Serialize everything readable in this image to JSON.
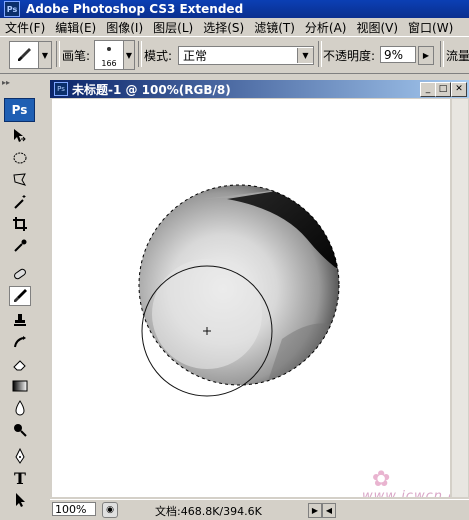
{
  "app": {
    "title": "Adobe Photoshop CS3 Extended",
    "logo": "Ps"
  },
  "menu": [
    "文件(F)",
    "编辑(E)",
    "图像(I)",
    "图层(L)",
    "选择(S)",
    "滤镜(T)",
    "分析(A)",
    "视图(V)",
    "窗口(W)"
  ],
  "options": {
    "brush_label": "画笔:",
    "brush_size": "166",
    "mode_label": "模式:",
    "mode_value": "正常",
    "opacity_label": "不透明度:",
    "opacity_value": "9%",
    "flow_label": "流量"
  },
  "toolbox": {
    "logo": "Ps",
    "tools": [
      "move-tool-icon",
      "ellipse-marquee-icon",
      "lasso-icon",
      "magic-wand-icon",
      "crop-icon",
      "eyedropper-icon",
      "healing-brush-icon",
      "brush-icon",
      "clone-stamp-icon",
      "history-brush-icon",
      "eraser-icon",
      "gradient-icon",
      "blur-icon",
      "dodge-icon",
      "pen-icon",
      "type-icon",
      "path-selection-icon"
    ]
  },
  "document": {
    "title": "未标题-1 @ 100%(RGB/8)",
    "logo": "Ps",
    "zoom": "100%",
    "doc_info": "文档:468.8K/394.6K"
  },
  "watermark": "www.jcwcn.com",
  "colors": {
    "title_bar": "#0a246a",
    "ps_blue": "#1f5fb3",
    "chrome": "#d4d0c8"
  }
}
